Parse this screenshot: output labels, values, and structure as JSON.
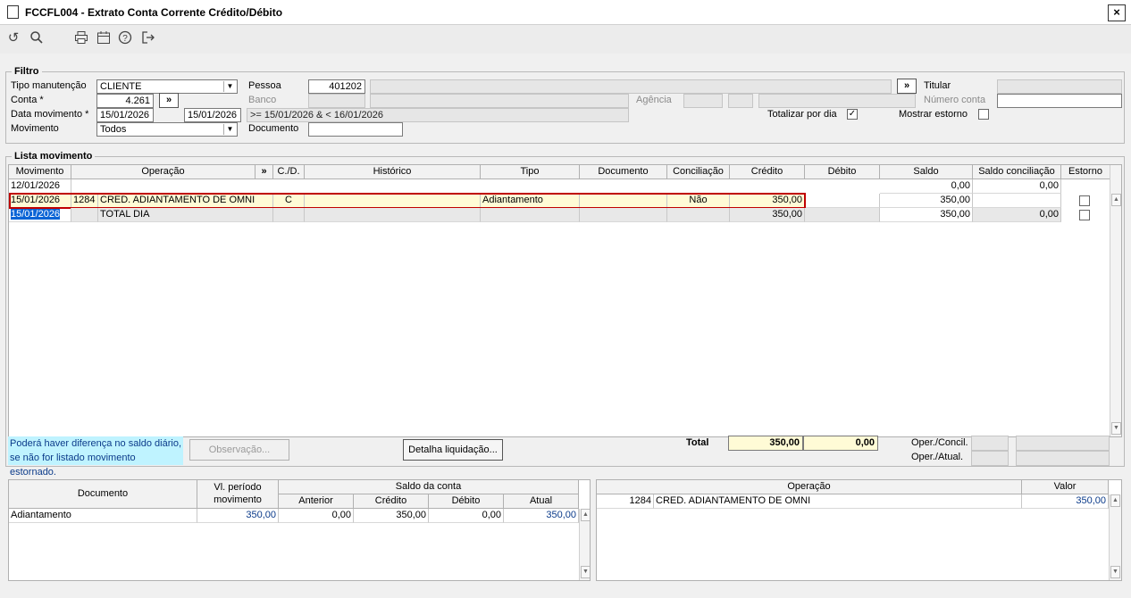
{
  "window": {
    "title": "FCCFL004 - Extrato Conta Corrente Crédito/Débito",
    "close": "×"
  },
  "toolbar": {
    "icons": [
      "refresh-icon",
      "search-icon",
      "print-icon",
      "calendar-icon",
      "help-icon",
      "exit-icon"
    ]
  },
  "filtro": {
    "legend": "Filtro",
    "tipo_manutencao": {
      "label": "Tipo manutenção",
      "value": "CLIENTE"
    },
    "conta": {
      "label": "Conta *",
      "value": "4.261",
      "btn": "»"
    },
    "data_movimento": {
      "label": "Data movimento *",
      "from": "15/01/2026",
      "to": "15/01/2026",
      "expr": ">= 15/01/2026  & < 16/01/2026"
    },
    "movimento": {
      "label": "Movimento",
      "value": "Todos"
    },
    "pessoa": {
      "label": "Pessoa",
      "value": "401202",
      "btn": "»"
    },
    "banco": {
      "label": "Banco"
    },
    "documento": {
      "label": "Documento",
      "value": ""
    },
    "agencia": {
      "label": "Agência"
    },
    "titular": {
      "label": "Titular"
    },
    "numero_conta": {
      "label": "Número conta"
    },
    "totalizar": {
      "label": "Totalizar por dia",
      "checked": "✓"
    },
    "mostrar_estorno": {
      "label": "Mostrar estorno"
    }
  },
  "lista": {
    "legend": "Lista movimento",
    "headers": [
      "Movimento",
      "Operação",
      "»",
      "C./D.",
      "Histórico",
      "Tipo",
      "Documento",
      "Conciliação",
      "Crédito",
      "Débito",
      "Saldo",
      "Saldo conciliação",
      "Estorno"
    ],
    "rows": [
      {
        "movimento": "12/01/2026",
        "cod": "",
        "operacao": "",
        "cd": "",
        "historico": "",
        "tipo": "",
        "documento": "",
        "conciliacao": "",
        "credito": "",
        "debito": "",
        "saldo": "0,00",
        "saldo_conc": "0,00"
      },
      {
        "movimento": "15/01/2026",
        "cod": "1284",
        "operacao": "CRED. ADIANTAMENTO DE OMNI",
        "cd": "C",
        "historico": "",
        "tipo": "Adiantamento",
        "documento": "",
        "conciliacao": "Não",
        "credito": "350,00",
        "debito": "",
        "saldo": "350,00",
        "saldo_conc": ""
      },
      {
        "movimento": "15/01/2026",
        "cod": "",
        "operacao": "TOTAL DIA",
        "cd": "",
        "historico": "",
        "tipo": "",
        "documento": "",
        "conciliacao": "",
        "credito": "350,00",
        "debito": "",
        "saldo": "350,00",
        "saldo_conc": "0,00"
      }
    ]
  },
  "footer": {
    "note_line1": "Poderá haver diferença no saldo diário,",
    "note_line2": "se não for listado movimento estornado.",
    "observacao_btn": "Observação...",
    "detalha_btn": "Detalha liquidação...",
    "total_label": "Total",
    "total_credito": "350,00",
    "total_debito": "0,00",
    "oper_concil": "Oper./Concil.",
    "oper_atual": "Oper./Atual."
  },
  "doc_grid": {
    "headers": {
      "documento": "Documento",
      "vl_periodo_1": "Vl. período",
      "vl_periodo_2": "movimento",
      "saldo_conta": "Saldo da conta",
      "anterior": "Anterior",
      "credito": "Crédito",
      "debito": "Débito",
      "atual": "Atual"
    },
    "rows": [
      {
        "documento": "Adiantamento",
        "vl_periodo": "350,00",
        "anterior": "0,00",
        "credito": "350,00",
        "debito": "0,00",
        "atual": "350,00"
      }
    ]
  },
  "op_grid": {
    "headers": {
      "operacao": "Operação",
      "valor": "Valor"
    },
    "rows": [
      {
        "cod": "1284",
        "operacao": "CRED. ADIANTAMENTO DE OMNI",
        "valor": "350,00"
      }
    ]
  },
  "colors": {
    "highlight_border": "#c00000",
    "selected_bg": "#0a64d6",
    "note_bg": "#bff3ff",
    "total_bg": "#fffbd6"
  }
}
